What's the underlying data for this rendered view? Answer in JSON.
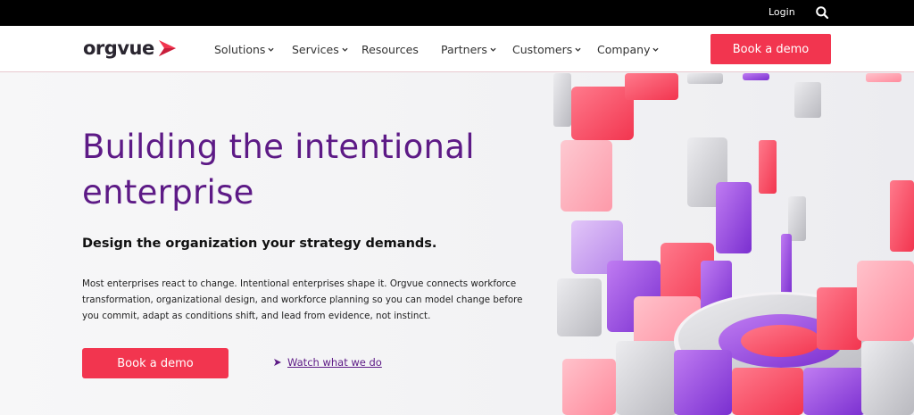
{
  "topbar": {
    "login_label": "Login",
    "search_icon": "search-icon"
  },
  "brand": {
    "logo_text": "orgvue",
    "accent": "#f2354f",
    "purple": "#5d1a86"
  },
  "nav": {
    "items": [
      {
        "label": "Solutions",
        "has_dropdown": true
      },
      {
        "label": "Services",
        "has_dropdown": true
      },
      {
        "label": "Resources",
        "has_dropdown": false
      },
      {
        "label": "Partners",
        "has_dropdown": true
      },
      {
        "label": "Customers",
        "has_dropdown": true
      },
      {
        "label": "Company",
        "has_dropdown": true
      }
    ],
    "cta_label": "Book a demo"
  },
  "hero": {
    "title": "Building the intentional enterprise",
    "subtitle": "Design the organization your strategy demands.",
    "body": "Most enterprises react to change. Intentional enterprises shape it. Orgvue connects workforce transformation, organizational design, and workforce planning so you can model change before you commit, adapt as conditions shift, and lead from evidence, not instinct.",
    "cta_label": "Book a demo",
    "watch_label": "Watch what we do"
  }
}
